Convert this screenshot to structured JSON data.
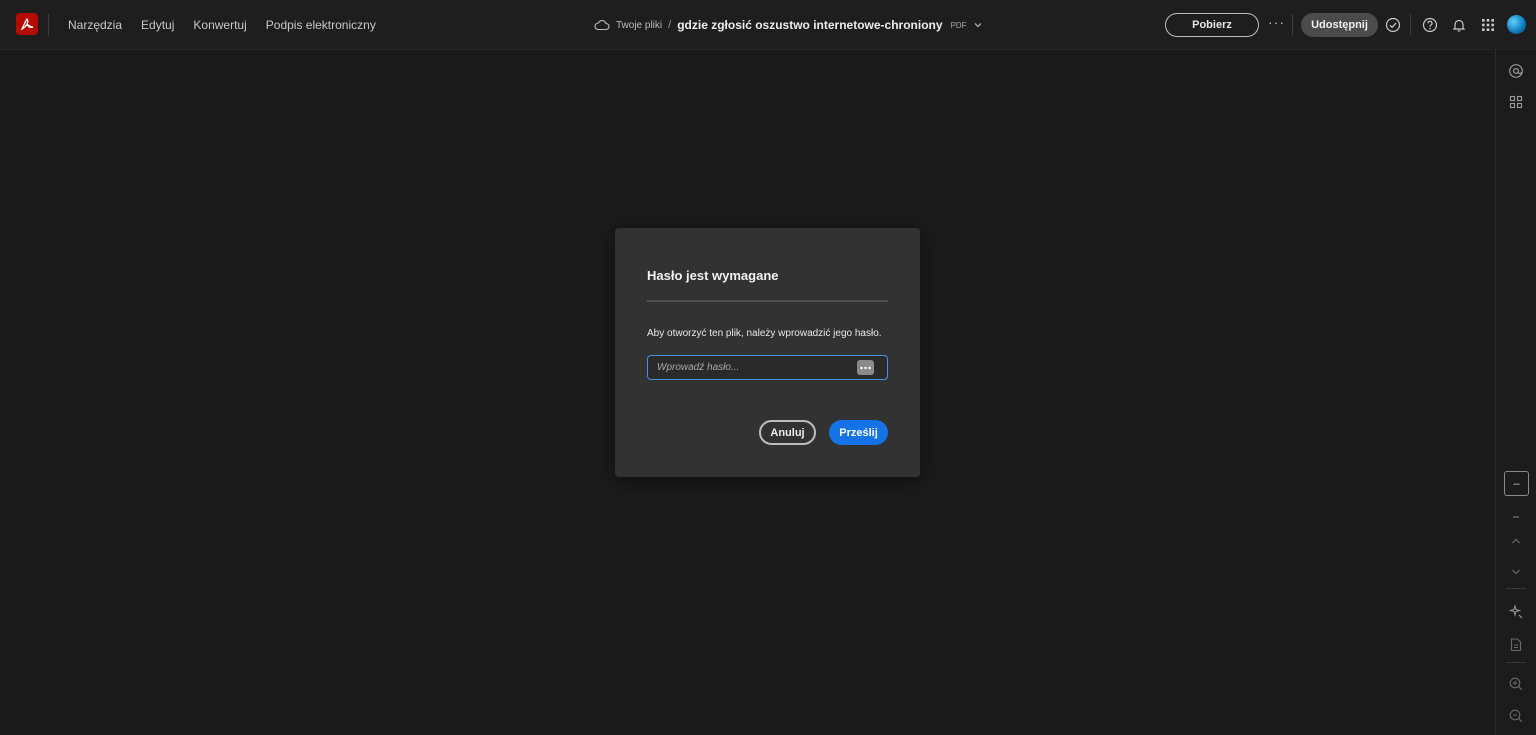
{
  "topbar": {
    "nav": [
      "Narzędzia",
      "Edytuj",
      "Konwertuj",
      "Podpis elektroniczny"
    ],
    "breadcrumb": {
      "location": "Twoje pliki",
      "separator": "/",
      "file_name": "gdzie zgłosić oszustwo internetowe-chroniony",
      "file_type": "PDF"
    },
    "download_label": "Pobierz",
    "more_label": "···",
    "share_label": "Udostępnij"
  },
  "right_rail": {
    "page_field": "–"
  },
  "dialog": {
    "title": "Hasło jest wymagane",
    "message": "Aby otworzyć ten plik, należy wprowadzić jego hasło.",
    "password_placeholder": "Wprowadź hasło...",
    "cancel_label": "Anuluj",
    "submit_label": "Prześlij"
  },
  "colors": {
    "background": "#1b1b1b",
    "dialog": "#323232",
    "accent": "#1473e6",
    "logo": "#b30b00"
  }
}
